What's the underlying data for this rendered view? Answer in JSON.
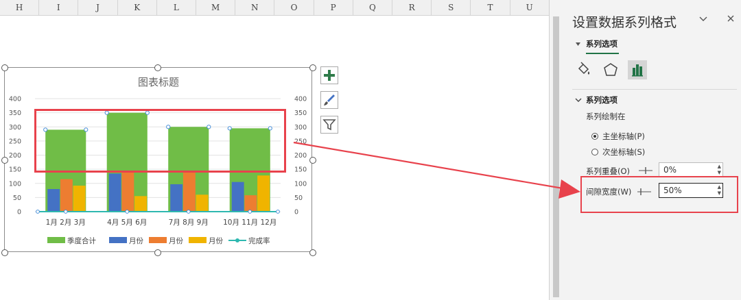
{
  "sheet": {
    "columns": [
      "H",
      "I",
      "J",
      "K",
      "L",
      "M",
      "N",
      "O",
      "P",
      "Q",
      "R",
      "S",
      "T",
      "U"
    ]
  },
  "chart": {
    "icons": {
      "add": "plus-icon",
      "style": "brush-icon",
      "filter": "funnel-icon"
    }
  },
  "chart_data": {
    "type": "bar",
    "title": "图表标题",
    "categories": [
      "1月 2月 3月",
      "4月 5月 6月",
      "7月 8月 9月",
      "10月 11月 12月"
    ],
    "ylim": [
      0,
      400
    ],
    "y_ticks": [
      0,
      50,
      100,
      150,
      200,
      250,
      300,
      350,
      400
    ],
    "secondary_y_ticks": [
      0,
      50,
      100,
      150,
      200,
      250,
      300,
      350,
      400
    ],
    "grid": true,
    "legend_position": "bottom",
    "series": [
      {
        "name": "季度合计",
        "color": "#70bd47",
        "values": [
          290,
          350,
          300,
          295
        ]
      },
      {
        "name": "月份",
        "color": "#4472c4",
        "values": [
          [
            80
          ],
          [
            135
          ],
          [
            97
          ],
          [
            105
          ]
        ]
      },
      {
        "name": "月份",
        "color": "#ed7d31",
        "values": [
          [
            115
          ],
          [
            145
          ],
          [
            145
          ],
          [
            58
          ]
        ]
      },
      {
        "name": "月份",
        "color": "#f0b400",
        "values": [
          [
            92
          ],
          [
            55
          ],
          [
            60
          ],
          [
            128
          ]
        ]
      },
      {
        "name": "完成率",
        "color": "#2eb8b0",
        "values": [
          0,
          0,
          0,
          0
        ]
      }
    ]
  },
  "pane": {
    "title": "设置数据系列格式",
    "tab_label": "系列选项",
    "icons": {
      "collapse": "chevron-down-icon",
      "close": "close-icon",
      "fill": "paint-bucket-icon",
      "effects": "pentagon-icon",
      "series": "bar-chart-icon"
    },
    "section_label": "系列选项",
    "plot_on_label": "系列绘制在",
    "primary_axis": "主坐标轴(P)",
    "secondary_axis": "次坐标轴(S)",
    "overlap_label": "系列重叠(O)",
    "overlap_value": "0%",
    "gap_label": "间隙宽度(W)",
    "gap_value": "50%"
  },
  "colors": {
    "annotation": "#e8424c",
    "accent": "#217346"
  }
}
